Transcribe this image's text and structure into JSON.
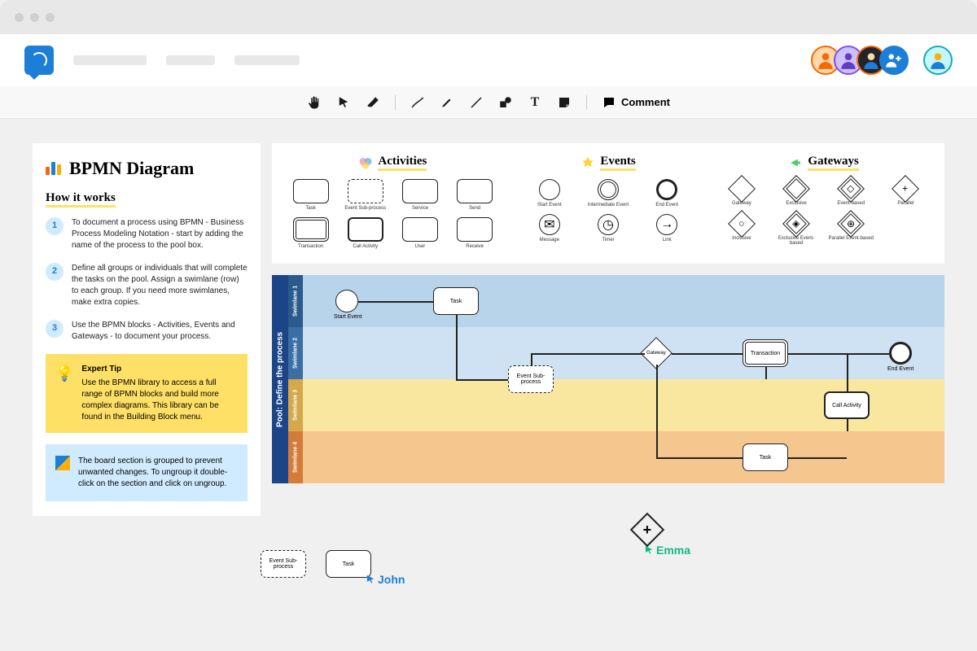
{
  "toolbar": {
    "comment": "Comment"
  },
  "sidebar": {
    "title": "BPMN Diagram",
    "howit": "How it works",
    "steps": [
      "To document a process using BPMN - Business Process Modeling Notation - start by adding the name of the process to the pool box.",
      "Define all groups or individuals that will complete the tasks on the pool. Assign a swimlane (row) to each group. If you need more swimlanes, make extra copies.",
      "Use the BPMN blocks - Activities, Events and Gateways - to document your process."
    ],
    "tip_title": "Expert Tip",
    "tip": "Use the BPMN library to access a full range of BPMN blocks and build more complex diagrams. This library can be found in the Building Block menu.",
    "note": "The board section is grouped to prevent unwanted changes. To ungroup it double-click on the section and click on ungroup."
  },
  "palette": {
    "activities": {
      "title": "Activities",
      "items": [
        "Task",
        "Event Sub-process",
        "Service",
        "Send",
        "Transaction",
        "Call Activity",
        "User",
        "Receive"
      ]
    },
    "events": {
      "title": "Events",
      "items": [
        "Start Event",
        "Intermediate Event",
        "End Event",
        "Message",
        "Timer",
        "Link"
      ]
    },
    "gateways": {
      "title": "Gateways",
      "items": [
        "Gateway",
        "Exclusive",
        "Event-based",
        "Parallel",
        "Inclusive",
        "Exclusive Event-based",
        "Parallel Event-based"
      ]
    }
  },
  "pool": {
    "label": "Pool: Define the process",
    "lanes": [
      "Swimlane 1",
      "Swimlane 2",
      "Swimlane 3",
      "Swimlane 4"
    ],
    "nodes": {
      "start": "Start Event",
      "task1": "Task",
      "sub": "Event Sub-process",
      "gw": "Gateway",
      "trans": "Transaction",
      "call": "Call Activity",
      "task2": "Task",
      "end": "End Event"
    }
  },
  "floating": {
    "sub": "Event Sub-process",
    "task": "Task",
    "john": "John",
    "emma": "Emma"
  }
}
